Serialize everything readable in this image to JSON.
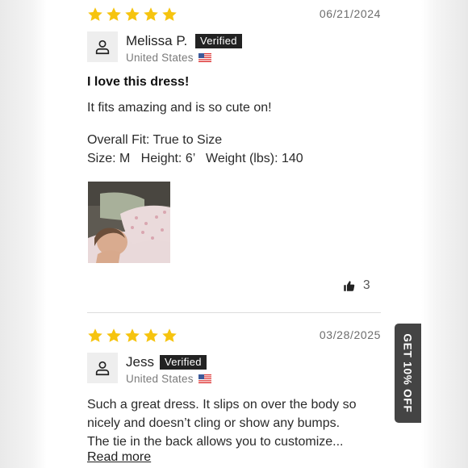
{
  "reviews": [
    {
      "rating": 5,
      "date": "06/21/2024",
      "author": "Melissa P.",
      "verified_label": "Verified",
      "country": "United States",
      "title": "I love this dress!",
      "body": "It fits amazing and is so cute on!",
      "fit_line": "Overall Fit: True to Size",
      "details_line": "Size: M   Height: 6’   Weight (lbs): 140",
      "helpful_count": "3"
    },
    {
      "rating": 5,
      "date": "03/28/2025",
      "author": "Jess",
      "verified_label": "Verified",
      "country": "United States",
      "body_lines": [
        "Such a great dress. It slips on over the body so",
        "nicely and doesn’t cling or show any bumps.",
        "The tie in the back allows you to customize..."
      ],
      "read_more": "Read more"
    }
  ],
  "promo_tab": {
    "label": "GET 10% OFF"
  },
  "icons": {
    "star": "star-icon",
    "avatar": "user-icon",
    "flag": "us-flag-icon",
    "helpful": "thumbs-up-icon"
  },
  "colors": {
    "star": "#f6c40f",
    "badge": "#222222",
    "promo": "#444444"
  }
}
